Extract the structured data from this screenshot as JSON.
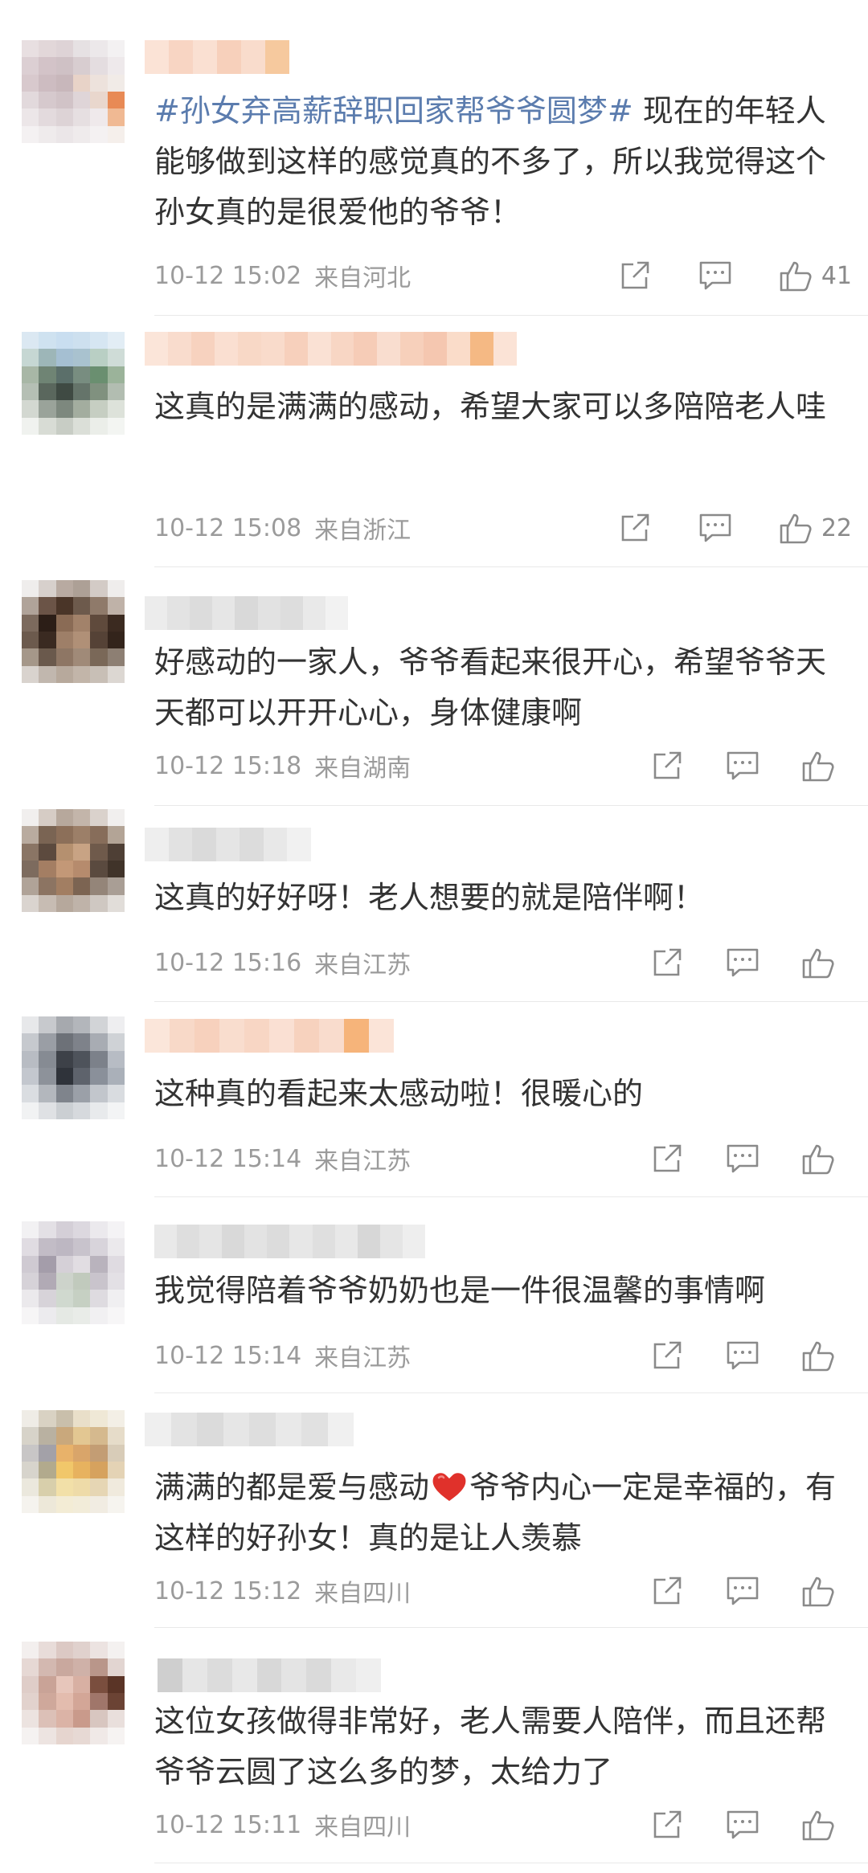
{
  "comments": [
    {
      "text": "现在的年轻人能够做到这样的感觉真的不多了，所以我觉得这个孙女真的是很爱他的爷爷！",
      "tag": "#孙女弃高薪辞职回家帮爷爷圆梦#",
      "date": "10-12 15:02",
      "location": "来自河北",
      "likes": "41"
    },
    {
      "text": "这真的是满满的感动，希望大家可以多陪陪老人哇",
      "date": "10-12 15:08",
      "location": "来自浙江",
      "likes": "22"
    },
    {
      "text": "好感动的一家人，爷爷看起来很开心，希望爷爷天天都可以开开心心，身体健康啊",
      "date": "10-12 15:18",
      "location": "来自湖南",
      "likes": ""
    },
    {
      "text": "这真的好好呀！老人想要的就是陪伴啊！",
      "date": "10-12 15:16",
      "location": "来自江苏",
      "likes": ""
    },
    {
      "text": "这种真的看起来太感动啦！很暖心的",
      "date": "10-12 15:14",
      "location": "来自江苏",
      "likes": ""
    },
    {
      "text": "我觉得陪着爷爷奶奶也是一件很温馨的事情啊",
      "date": "10-12 15:14",
      "location": "来自江苏",
      "likes": ""
    },
    {
      "text_before": "满满的都是爱与感动",
      "text_after": "爷爷内心一定是幸福的，有这样的好孙女！真的是让人羡慕",
      "date": "10-12 15:12",
      "location": "来自四川",
      "likes": ""
    },
    {
      "text": "这位女孩做得非常好，老人需要人陪伴，而且还帮爷爷云圆了这么多的梦，太给力了",
      "date": "10-12 15:11",
      "location": "来自四川",
      "likes": ""
    }
  ],
  "icons": {
    "share": "share-icon",
    "comment": "comment-icon",
    "like": "thumbs-up-icon"
  },
  "colors": {
    "hashtag": "#5b7cae",
    "text": "#333333",
    "meta": "#9b9b9b",
    "heart": "#e0312b"
  }
}
